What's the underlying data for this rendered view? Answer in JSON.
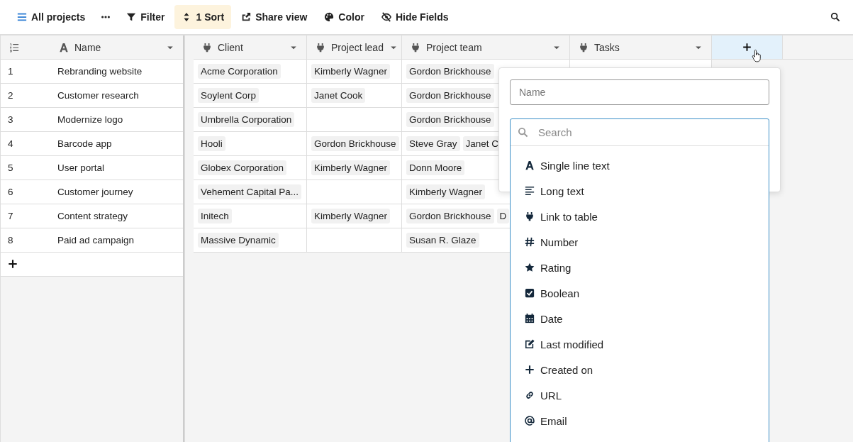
{
  "toolbar": {
    "items": [
      {
        "kind": "view",
        "label": "All projects",
        "active": false
      },
      {
        "kind": "more",
        "active": false
      },
      {
        "kind": "filter",
        "label": "Filter",
        "active": false
      },
      {
        "kind": "sort",
        "label": "1 Sort",
        "active": true
      },
      {
        "kind": "share",
        "label": "Share view",
        "active": false
      },
      {
        "kind": "color",
        "label": "Color",
        "active": false
      },
      {
        "kind": "hide",
        "label": "Hide Fields",
        "active": false
      }
    ]
  },
  "table": {
    "columns": [
      {
        "kind": "text",
        "label": "Name"
      },
      {
        "kind": "link",
        "label": "Client"
      },
      {
        "kind": "link",
        "label": "Project lead"
      },
      {
        "kind": "link",
        "label": "Project team"
      },
      {
        "kind": "link",
        "label": "Tasks"
      }
    ],
    "rows": [
      {
        "number": "1",
        "name": "Rebranding website",
        "client": [
          "Acme Corporation"
        ],
        "project_lead": [
          "Kimberly Wagner"
        ],
        "project_team": [
          "Gordon Brickhouse"
        ]
      },
      {
        "number": "2",
        "name": "Customer research",
        "client": [
          "Soylent Corp"
        ],
        "project_lead": [
          "Janet Cook"
        ],
        "project_team": [
          "Gordon Brickhouse"
        ]
      },
      {
        "number": "3",
        "name": "Modernize logo",
        "client": [
          "Umbrella Corporation"
        ],
        "project_lead": [],
        "project_team": [
          "Gordon Brickhouse"
        ]
      },
      {
        "number": "4",
        "name": "Barcode app",
        "client": [
          "Hooli"
        ],
        "project_lead": [
          "Gordon Brickhouse"
        ],
        "project_team": [
          "Steve Gray",
          "Janet C"
        ]
      },
      {
        "number": "5",
        "name": "User portal",
        "client": [
          "Globex Corporation"
        ],
        "project_lead": [
          "Kimberly Wagner"
        ],
        "project_team": [
          "Donn Moore"
        ]
      },
      {
        "number": "6",
        "name": "Customer journey",
        "client": [
          "Vehement Capital Pa..."
        ],
        "project_lead": [],
        "project_team": [
          "Kimberly Wagner"
        ]
      },
      {
        "number": "7",
        "name": "Content strategy",
        "client": [
          "Initech"
        ],
        "project_lead": [
          "Kimberly Wagner"
        ],
        "project_team": [
          "Gordon Brickhouse",
          "D"
        ]
      },
      {
        "number": "8",
        "name": "Paid ad campaign",
        "client": [
          "Massive Dynamic"
        ],
        "project_lead": [],
        "project_team": [
          "Susan R. Glaze"
        ]
      }
    ]
  },
  "new_field_popup": {
    "name_field": {
      "placeholder": "Name"
    },
    "search_field": {
      "placeholder": "Search"
    },
    "field_types": [
      {
        "kind": "single_line",
        "label": "Single line text"
      },
      {
        "kind": "long_text",
        "label": "Long text"
      },
      {
        "kind": "link",
        "label": "Link to table"
      },
      {
        "kind": "number",
        "label": "Number"
      },
      {
        "kind": "rating",
        "label": "Rating"
      },
      {
        "kind": "boolean",
        "label": "Boolean"
      },
      {
        "kind": "date",
        "label": "Date"
      },
      {
        "kind": "last_modified",
        "label": "Last modified"
      },
      {
        "kind": "created_on",
        "label": "Created on"
      },
      {
        "kind": "url",
        "label": "URL"
      },
      {
        "kind": "email",
        "label": "Email"
      }
    ]
  }
}
